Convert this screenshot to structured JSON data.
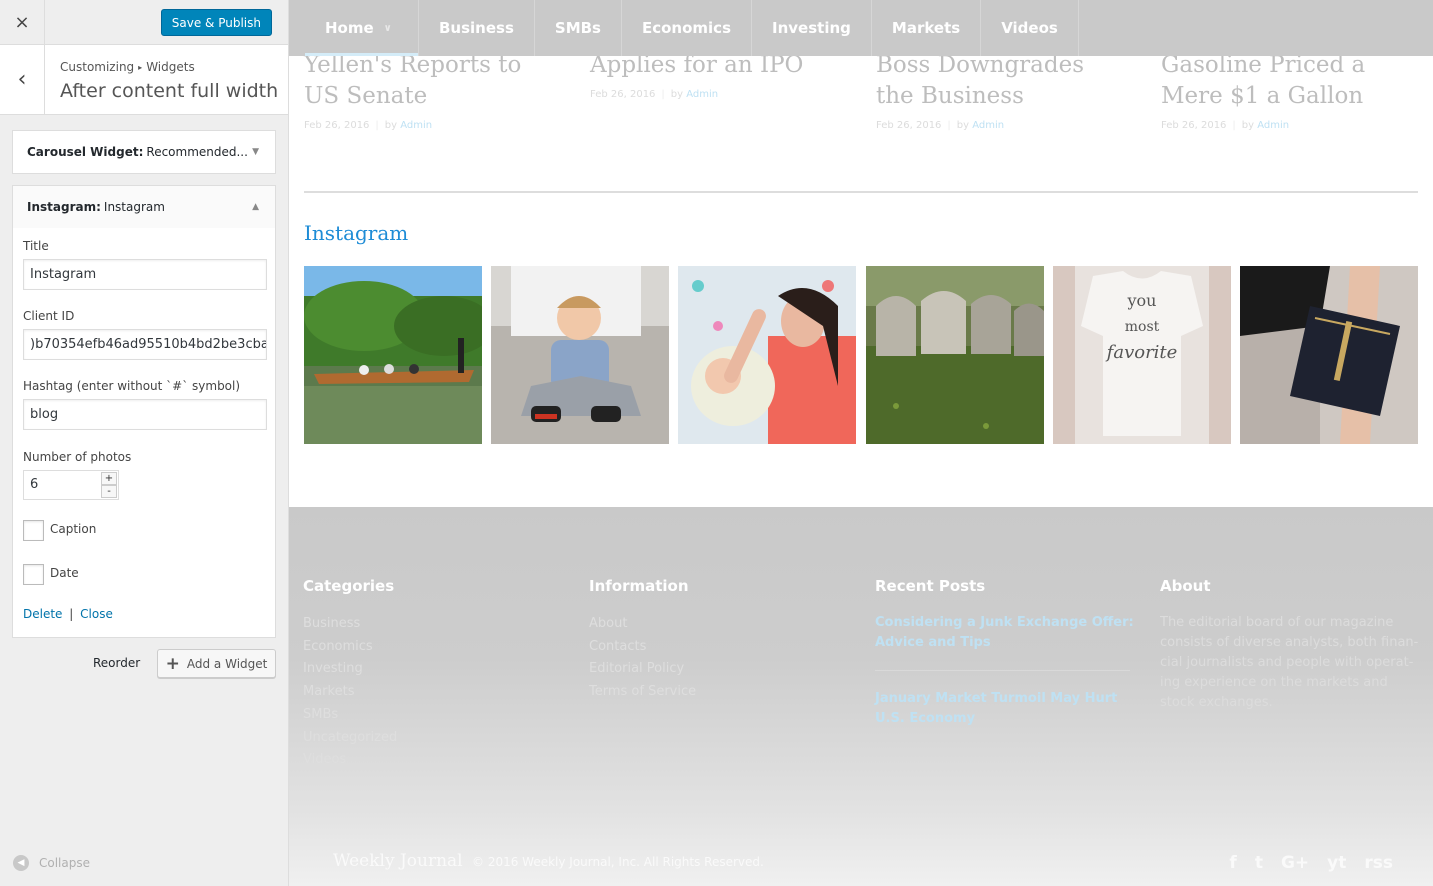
{
  "customizer": {
    "close_icon": "×",
    "publish_label": "Save & Publish",
    "back_icon": "‹",
    "breadcrumb": {
      "root": "Customizing",
      "arrow": "▸",
      "section": "Widgets"
    },
    "section_title": "After content full width ...",
    "widgets": [
      {
        "type": "Carousel Widget:",
        "title": "Recommended...",
        "state": "collapsed"
      },
      {
        "type": "Instagram:",
        "title": "Instagram",
        "state": "expanded"
      }
    ],
    "form": {
      "title_label": "Title",
      "title_value": "Instagram",
      "client_label": "Client ID",
      "client_value": ")b70354efb46ad95510b4bd2be3cba",
      "hashtag_label": "Hashtag (enter without `#` symbol)",
      "hashtag_value": "blog",
      "photos_label": "Number of photos",
      "photos_value": "6",
      "caption_label": "Caption",
      "date_label": "Date",
      "delete_label": "Delete",
      "sep": "|",
      "close_label": "Close"
    },
    "reorder_label": "Reorder",
    "add_widget_label": "Add a Widget",
    "collapse_label": "Collapse"
  },
  "preview": {
    "nav": [
      "Home",
      "Business",
      "SMBs",
      "Economics",
      "Investing",
      "Markets",
      "Videos"
    ],
    "posts": [
      {
        "title_l1": "Yellen's Reports to",
        "title_l2": "US Senate",
        "date": "Feb 26, 2016",
        "by": "by",
        "author": "Admin"
      },
      {
        "title_l1": "Applies for an IPO",
        "title_l2": "",
        "date": "Feb 26, 2016",
        "by": "by",
        "author": "Admin"
      },
      {
        "title_l1": "Boss Downgrades",
        "title_l2": "the Business",
        "date": "Feb 26, 2016",
        "by": "by",
        "author": "Admin"
      },
      {
        "title_l1": "Gasoline Priced a",
        "title_l2": "Mere $1 a Gallon",
        "date": "Feb 26, 2016",
        "by": "by",
        "author": "Admin"
      }
    ],
    "instagram_heading": "Instagram",
    "footer": {
      "categories_title": "Categories",
      "categories": [
        "Business",
        "Economics",
        "Investing",
        "Markets",
        "SMBs",
        "Uncategorized",
        "Videos"
      ],
      "information_title": "Information",
      "information": [
        "About",
        "Contacts",
        "Editorial Policy",
        "Terms of Service"
      ],
      "recent_title": "Recent Posts",
      "recent": [
        "Considering a Junk Exchange Offer: Advice and Tips",
        "January Market Turmoil May Hurt U.S. Economy"
      ],
      "about_title": "About",
      "about_text": "The editorial board of our magazine consists of diverse analysts, both finan-cial journalists and people with operat-ing experience on the markets and stock exchanges.",
      "brand": "Weekly Journal",
      "copyright": "© 2016 Weekly Journal, Inc. All Rights Reserved.",
      "social": [
        "f",
        "t",
        "G+",
        "yt",
        "rss"
      ]
    }
  }
}
